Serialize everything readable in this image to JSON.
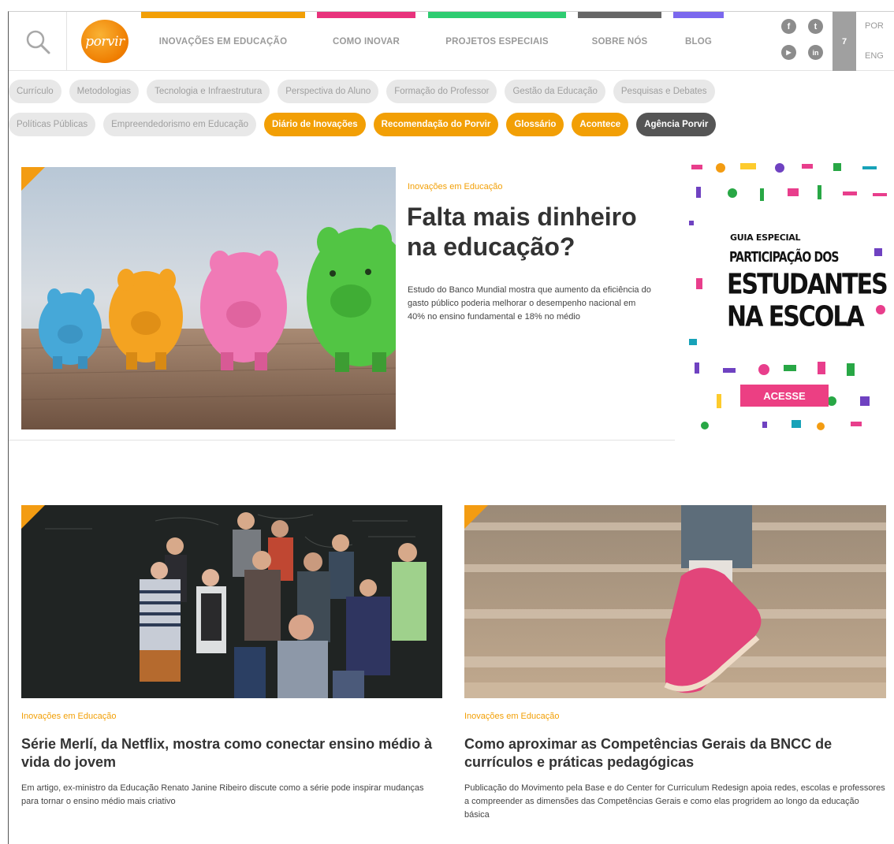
{
  "header": {
    "logo_text": "porvir",
    "nav": [
      {
        "label": "INOVAÇÕES EM EDUCAÇÃO",
        "color": "#f29f05"
      },
      {
        "label": "COMO INOVAR",
        "color": "#e8327c"
      },
      {
        "label": "PROJETOS ESPECIAIS",
        "color": "#2ecc71"
      },
      {
        "label": "SOBRE NÓS",
        "color": "#666666"
      },
      {
        "label": "BLOG",
        "color": "#7b68ee"
      }
    ],
    "social": [
      "f",
      "t",
      "▶",
      "in"
    ],
    "badge": "7",
    "lang_por": "POR",
    "lang_eng": "ENG"
  },
  "tags_row1": [
    "Currículo",
    "Metodologias",
    "Tecnologia e Infraestrutura",
    "Perspectiva do Aluno",
    "Formação do Professor",
    "Gestão da Educação",
    "Pesquisas e Debates"
  ],
  "tags_row2": [
    "Políticas Públicas",
    "Empreendedorismo em Educação"
  ],
  "tags_orange": [
    "Diário de Inovações",
    "Recomendação do Porvir",
    "Glossário",
    "Acontece"
  ],
  "tag_dark": "Agência Porvir",
  "featured": {
    "category": "Inovações em Educação",
    "title": "Falta mais dinheiro na educação?",
    "description": "Estudo do Banco Mundial mostra que aumento da eficiência do gasto público poderia melhorar o desempenho nacional em 40% no ensino fundamental e 18% no médio"
  },
  "ad": {
    "kicker": "GUIA ESPECIAL",
    "line1": "PARTICIPAÇÃO DOS",
    "line2": "ESTUDANTES",
    "line3": "NA ESCOLA",
    "button": "ACESSE"
  },
  "articles": [
    {
      "category": "Inovações em Educação",
      "title": "Série Merlí, da Netflix, mostra como conectar ensino médio à vida do jovem",
      "description": "Em artigo, ex-ministro da Educação Renato Janine Ribeiro discute como a série pode inspirar mudanças para tornar o ensino médio mais criativo"
    },
    {
      "category": "Inovações em Educação",
      "title": "Como aproximar as Competências Gerais da BNCC de currículos e práticas pedagógicas",
      "description": "Publicação do Movimento pela Base e do Center for Curriculum Redesign apoia redes, escolas e professores a compreender as dimensões das Competências Gerais e como elas progridem ao longo da educação básica"
    }
  ]
}
